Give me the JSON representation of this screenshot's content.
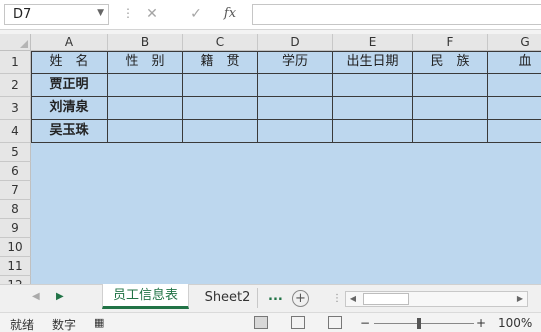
{
  "formula_bar": {
    "name_box": "D7",
    "cancel_icon": "✕",
    "enter_icon": "✓",
    "fx": "fx",
    "content": ""
  },
  "columns": [
    "A",
    "B",
    "C",
    "D",
    "E",
    "F",
    "G"
  ],
  "rows": [
    "1",
    "2",
    "3",
    "4",
    "5",
    "6",
    "7",
    "8",
    "9",
    "10",
    "11",
    "12"
  ],
  "table": {
    "headers": [
      "姓　名",
      "性　别",
      "籍　贯",
      "学历",
      "出生日期",
      "民　族",
      "血"
    ],
    "names": [
      "贾正明",
      "刘清泉",
      "吴玉珠"
    ]
  },
  "sheets": {
    "active": "员工信息表",
    "other": "Sheet2",
    "more": "...",
    "add": "+"
  },
  "status_bar": {
    "ready": "就绪",
    "mode": "数字",
    "zoom_minus": "−",
    "zoom_plus": "+",
    "zoom_value": "100%"
  },
  "colors": {
    "cell_fill": "#bdd7ee",
    "accent": "#217346"
  }
}
